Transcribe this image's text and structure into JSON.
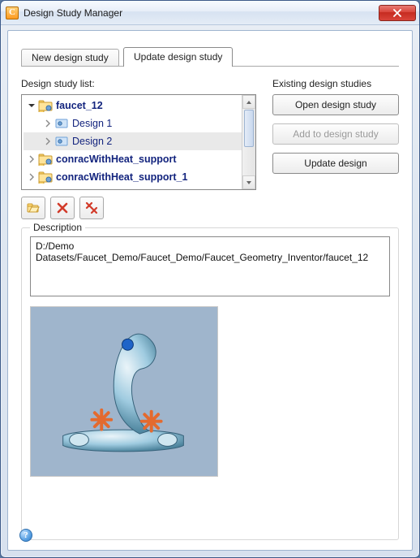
{
  "window": {
    "title": "Design Study Manager"
  },
  "tabs": {
    "new_label": "New design study",
    "update_label": "Update design study",
    "active": "update"
  },
  "left": {
    "list_label": "Design study list:",
    "tree": [
      {
        "id": "faucet_12",
        "label": "faucet_12",
        "level": 1,
        "expanded": true,
        "icon": "folder-gear",
        "bold": true
      },
      {
        "id": "design_1",
        "label": "Design 1",
        "level": 2,
        "expanded": false,
        "icon": "design",
        "bold": false
      },
      {
        "id": "design_2",
        "label": "Design 2",
        "level": 2,
        "expanded": false,
        "icon": "design",
        "bold": false,
        "selected": true
      },
      {
        "id": "conracWithHeat_support",
        "label": "conracWithHeat_support",
        "level": 1,
        "expanded": false,
        "icon": "folder-gear",
        "bold": true
      },
      {
        "id": "conracWithHeat_support_1",
        "label": "conracWithHeat_support_1",
        "level": 1,
        "expanded": false,
        "icon": "folder-gear",
        "bold": true
      }
    ],
    "toolbar": {
      "open": "open-folder-icon",
      "delete": "delete-icon",
      "delete_all": "delete-all-icon"
    }
  },
  "right": {
    "heading": "Existing design studies",
    "open_label": "Open design study",
    "add_label": "Add to design study",
    "update_label": "Update design",
    "add_enabled": false
  },
  "description": {
    "legend": "Description",
    "text": "D:/Demo Datasets/Faucet_Demo/Faucet_Demo/Faucet_Geometry_Inventor/faucet_12"
  },
  "help": {
    "tooltip": "Help"
  }
}
